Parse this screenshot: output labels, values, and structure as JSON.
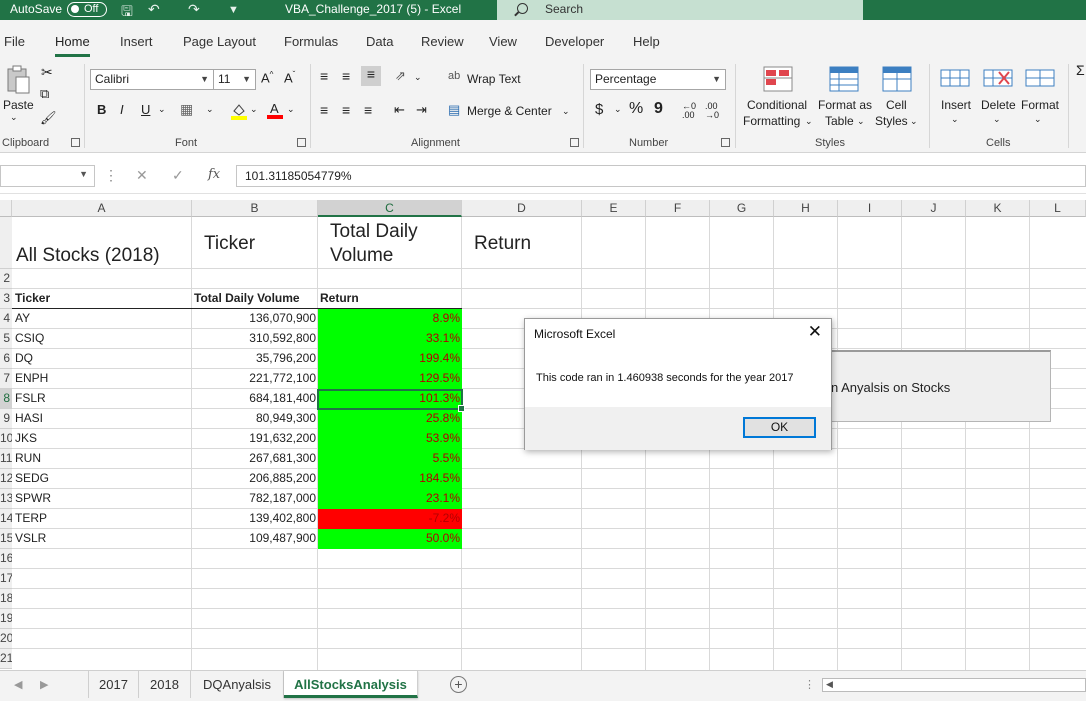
{
  "titlebar": {
    "autosave_label": "AutoSave",
    "autosave_state": "Off",
    "doc_title": "VBA_Challenge_2017 (5)  -  Excel",
    "search_placeholder": "Search"
  },
  "ribbon_tabs": [
    "File",
    "Home",
    "Insert",
    "Page Layout",
    "Formulas",
    "Data",
    "Review",
    "View",
    "Developer",
    "Help"
  ],
  "ribbon": {
    "clipboard": {
      "paste": "Paste",
      "label": "Clipboard"
    },
    "font": {
      "name": "Calibri",
      "size": "11",
      "bold": "B",
      "italic": "I",
      "underline": "U",
      "grow": "A^",
      "shrink": "Aˇ",
      "label": "Font"
    },
    "alignment": {
      "wrap_text": "Wrap Text",
      "merge_center": "Merge & Center",
      "label": "Alignment"
    },
    "number": {
      "format": "Percentage",
      "currency": "$",
      "percent": "%",
      "comma": "9",
      "inc_decimal": ".00",
      "dec_decimal": ".00",
      "label": "Number"
    },
    "styles": {
      "conditional_1": "Conditional",
      "conditional_2": "Formatting",
      "format_as_1": "Format as",
      "format_as_2": "Table",
      "cell_1": "Cell",
      "cell_2": "Styles",
      "label": "Styles"
    },
    "cells": {
      "insert": "Insert",
      "delete": "Delete",
      "format": "Format",
      "label": "Cells"
    }
  },
  "formula_bar": {
    "value": "101.31185054779%",
    "fx": "fx"
  },
  "columns": [
    "A",
    "B",
    "C",
    "D",
    "E",
    "F",
    "G",
    "H",
    "I",
    "J",
    "K",
    "L"
  ],
  "row_numbers": [
    "",
    "2",
    "3",
    "4",
    "5",
    "6",
    "7",
    "8",
    "9",
    "10",
    "11",
    "12",
    "13",
    "14",
    "15",
    "16",
    "17",
    "18",
    "19",
    "20",
    "21"
  ],
  "sheet": {
    "title": "All Stocks (2018)",
    "header_ticker_big": "Ticker",
    "header_volume_big_1": "Total Daily",
    "header_volume_big_2": "Volume",
    "header_return_big": "Return",
    "header_ticker": "Ticker",
    "header_volume": "Total Daily Volume",
    "header_return": "Return",
    "rows": [
      {
        "ticker": "AY",
        "volume": "136,070,900",
        "ret": "8.9%",
        "color": "#00ff00"
      },
      {
        "ticker": "CSIQ",
        "volume": "310,592,800",
        "ret": "33.1%",
        "color": "#00ff00"
      },
      {
        "ticker": "DQ",
        "volume": "35,796,200",
        "ret": "199.4%",
        "color": "#00ff00"
      },
      {
        "ticker": "ENPH",
        "volume": "221,772,100",
        "ret": "129.5%",
        "color": "#00ff00"
      },
      {
        "ticker": "FSLR",
        "volume": "684,181,400",
        "ret": "101.3%",
        "color": "#00ff00"
      },
      {
        "ticker": "HASI",
        "volume": "80,949,300",
        "ret": "25.8%",
        "color": "#00ff00"
      },
      {
        "ticker": "JKS",
        "volume": "191,632,200",
        "ret": "53.9%",
        "color": "#00ff00"
      },
      {
        "ticker": "RUN",
        "volume": "267,681,300",
        "ret": "5.5%",
        "color": "#00ff00"
      },
      {
        "ticker": "SEDG",
        "volume": "206,885,200",
        "ret": "184.5%",
        "color": "#00ff00"
      },
      {
        "ticker": "SPWR",
        "volume": "782,187,000",
        "ret": "23.1%",
        "color": "#00ff00"
      },
      {
        "ticker": "TERP",
        "volume": "139,402,800",
        "ret": "-7.2%",
        "color": "#ff0000"
      },
      {
        "ticker": "VSLR",
        "volume": "109,487,900",
        "ret": "50.0%",
        "color": "#00ff00"
      }
    ]
  },
  "background_button": {
    "label": "n Anyalsis on Stocks"
  },
  "dialog": {
    "title": "Microsoft Excel",
    "message": "This code ran in 1.460938 seconds for the year 2017",
    "ok": "OK",
    "close": "✕"
  },
  "sheet_tabs": [
    "2017",
    "2018",
    "DQAnyalsis",
    "AllStocksAnalysis"
  ],
  "active_sheet": "AllStocksAnalysis",
  "colors": {
    "excel_green": "#217346",
    "positive": "#00ff00",
    "negative": "#ff0000"
  }
}
